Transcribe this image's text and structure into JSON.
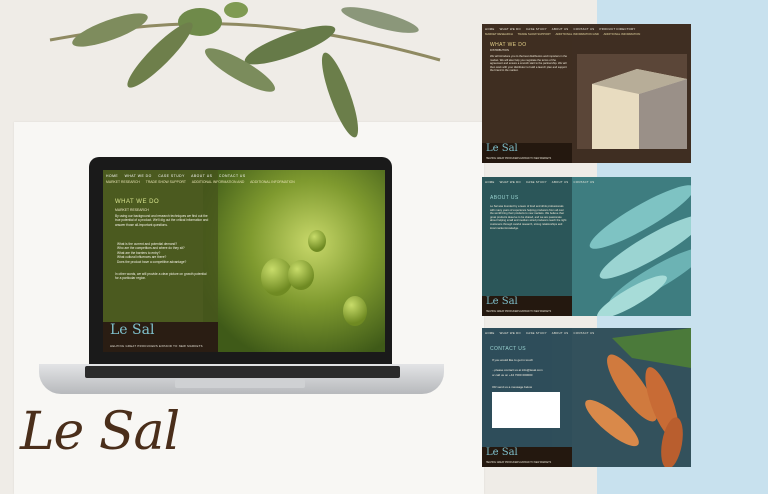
{
  "colors": {
    "accent_blue": "#c8e1ee",
    "brand_brown": "#4a2e1a",
    "logo_teal": "#7fc0cc"
  },
  "brand": {
    "logo_text": "Le Sal"
  },
  "laptop_site": {
    "nav_primary": [
      "HOME",
      "WHAT WE DO",
      "CASE STUDY",
      "ABOUT US",
      "CONTACT US"
    ],
    "nav_secondary": [
      "MARKET RESEARCH",
      "TRADE SHOW SUPPORT",
      "ADDITIONAL INFORMATION AND",
      "ADDITIONAL INFORMATION"
    ],
    "title": "WHAT WE DO",
    "subtitle": "MARKET RESEARCH",
    "intro": "By using our background and research techniques we find out the true potential of a product. We'll dig out the critical information and answer those all-important questions.",
    "bullets": [
      "What is the current and potential demand?",
      "Who are the competitors and where do they sit?",
      "What are the barriers to entry?",
      "What cultural influences are there?",
      "Does the product have a competitive advantage?"
    ],
    "closing": "In other words, we will provide a clear picture on growth potential for a particular region.",
    "tagline": "HELPING GREAT PRODUCERS EXPAND TO NEW MARKETS"
  },
  "mockups": [
    {
      "name": "what-we-do",
      "nav_primary": [
        "HOME",
        "WHAT WE DO",
        "CASE STUDY",
        "ABOUT US",
        "CONTACT US",
        "PRODUCT DIRECTORY"
      ],
      "nav_secondary": [
        "MARKET RESEARCH",
        "TRADE SHOW SUPPORT",
        "ADDITIONAL INFORMATION AND",
        "ADDITIONAL INFORMATION"
      ],
      "title": "WHAT WE DO",
      "subtitle": "DISTRIBUTION",
      "body": "We will introduce you to the best distributors and importers in the market. We will also help you negotiate the terms of the agreement and ensure a smooth start to the partnership. We will then work with your distributor to build a launch plan and support the brand in the market.",
      "tagline": "HELPING GREAT PRODUCERS EXPAND TO NEW MARKETS"
    },
    {
      "name": "about-us",
      "nav_primary": [
        "HOME",
        "WHAT WE DO",
        "CASE STUDY",
        "ABOUT US",
        "CONTACT US"
      ],
      "title": "ABOUT US",
      "body": "Le Sal was founded by a team of food and drink professionals with many years of experience helping producers from all over the world bring their products to new markets. We believe that great products deserve to be shared, and we are passionate about helping small and medium sized producers reach the right customers through careful research, strong relationships and local market knowledge.",
      "tagline": "HELPING GREAT PRODUCERS EXPAND TO NEW MARKETS"
    },
    {
      "name": "contact-us",
      "nav_primary": [
        "HOME",
        "WHAT WE DO",
        "CASE STUDY",
        "ABOUT US",
        "CONTACT US"
      ],
      "title": "CONTACT US",
      "line1": "If you would like to get in touch",
      "line2": "...please contact us at info@lesal.com",
      "line3": "or call us on +44 7000 000000",
      "line4": "OR send us a message below",
      "tagline": "HELPING GREAT PRODUCERS EXPAND TO NEW MARKETS"
    }
  ]
}
